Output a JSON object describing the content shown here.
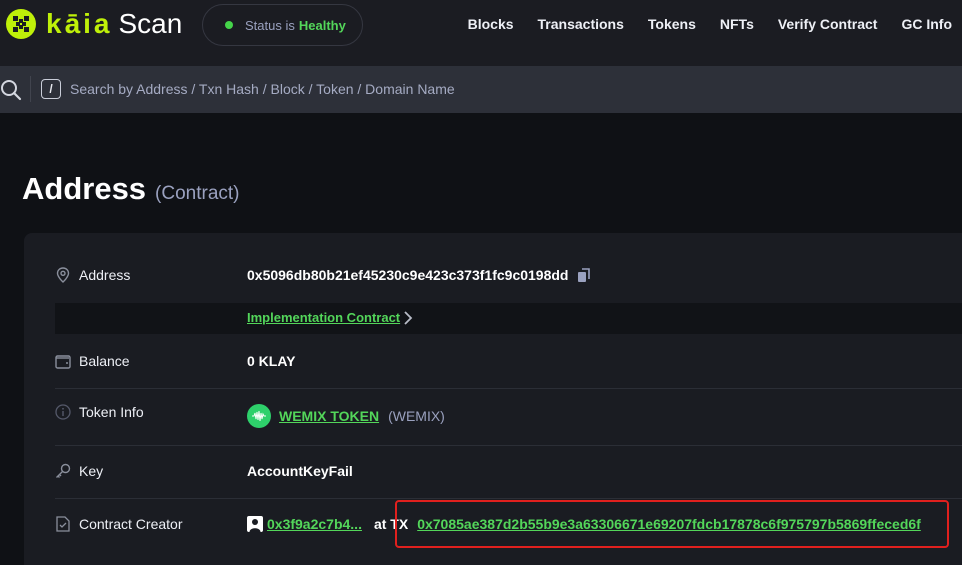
{
  "header": {
    "logo_word": "kāia",
    "logo_suffix": "Scan",
    "status": {
      "label": "Status is",
      "value": "Healthy",
      "color": "#53d65a"
    },
    "nav": [
      "Blocks",
      "Transactions",
      "Tokens",
      "NFTs",
      "Verify Contract",
      "GC Info"
    ]
  },
  "search": {
    "shortcut_key": "/",
    "placeholder": "Search by Address / Txn Hash / Block / Token / Domain Name"
  },
  "page": {
    "title": "Address",
    "subtitle": "(Contract)"
  },
  "details": {
    "address": {
      "label": "Address",
      "value": "0x5096db80b21ef45230c9e423c373f1fc9c0198dd"
    },
    "implementation_link": "Implementation Contract",
    "balance": {
      "label": "Balance",
      "value": "0 KLAY"
    },
    "token_info": {
      "label": "Token Info",
      "name": "WEMIX TOKEN",
      "symbol": "(WEMIX)"
    },
    "key": {
      "label": "Key",
      "value": "AccountKeyFail"
    },
    "contract_creator": {
      "label": "Contract Creator",
      "creator": "0x3f9a2c7b4...",
      "at_tx_label": "at TX",
      "tx_hash": "0x7085ae387d2b55b9e3a63306671e69207fdcb17878c6f975797b5869ffeced6f"
    }
  },
  "colors": {
    "brand": "#bff009",
    "link": "#53d65a",
    "highlight": "#e0201e"
  }
}
